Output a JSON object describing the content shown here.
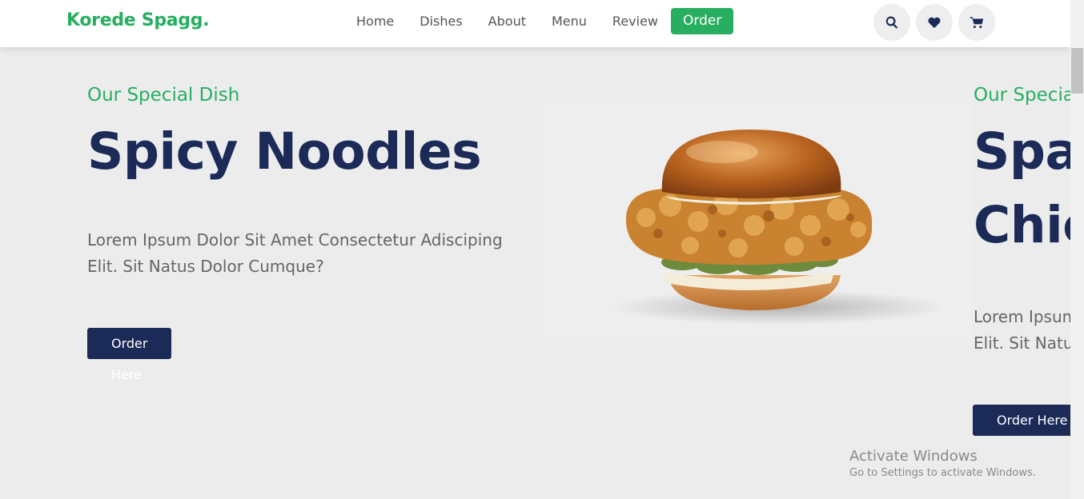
{
  "header": {
    "logo": "Korede Spagg.",
    "nav": [
      "Home",
      "Dishes",
      "About",
      "Menu",
      "Review"
    ],
    "order_label": "Order",
    "icons": [
      "search-icon",
      "heart-icon",
      "cart-icon"
    ]
  },
  "slides": [
    {
      "subtitle": "Our Special Dish",
      "title": "Spicy Noodles",
      "description": "Lorem Ipsum Dolor Sit Amet Consectetur Adisciping Elit. Sit Natus Dolor Cumque?",
      "button": "Order Here"
    },
    {
      "subtitle": "Our Special Dish",
      "title_line1": "Spa",
      "title_line2": "Chic",
      "description_line1": "Lorem Ipsum",
      "description_line2": "Elit. Sit Natu",
      "button": "Order Here"
    }
  ],
  "watermark": {
    "title": "Activate Windows",
    "subtitle": "Go to Settings to activate Windows."
  },
  "colors": {
    "brand_green": "#27ae60",
    "navy": "#1b2a57",
    "background": "#ececed"
  }
}
